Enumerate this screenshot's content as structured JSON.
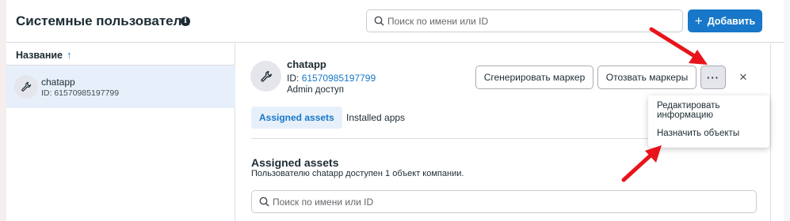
{
  "header": {
    "title": "Системные пользователи",
    "info_icon": "info-icon",
    "search_placeholder": "Поиск по имени или ID",
    "add_label": "Добавить"
  },
  "list": {
    "column_header": "Название",
    "sort_icon": "arrow-up-icon",
    "items": [
      {
        "name": "chatapp",
        "id": "ID: 61570985197799",
        "icon": "wrench-icon"
      }
    ]
  },
  "detail": {
    "name": "chatapp",
    "id_label": "ID:",
    "id_value": "61570985197799",
    "role": "Admin доступ",
    "generate_label": "Сгенерировать маркер",
    "revoke_label": "Отозвать маркеры",
    "more_label": "···",
    "close_label": "×",
    "tabs": [
      {
        "label": "Assigned assets",
        "active": true
      },
      {
        "label": "Installed apps",
        "active": false
      }
    ],
    "section_title": "Assigned assets",
    "section_desc": "Пользователю chatapp доступен 1 объект компании.",
    "search_placeholder": "Поиск по имени или ID"
  },
  "menu": {
    "items": [
      {
        "label": "Редактировать информацию"
      },
      {
        "label": "Назначить объекты"
      }
    ]
  },
  "colors": {
    "accent": "#1877c9",
    "selected_bg": "#e7f0fa",
    "annotation_arrow": "#e8141b"
  }
}
